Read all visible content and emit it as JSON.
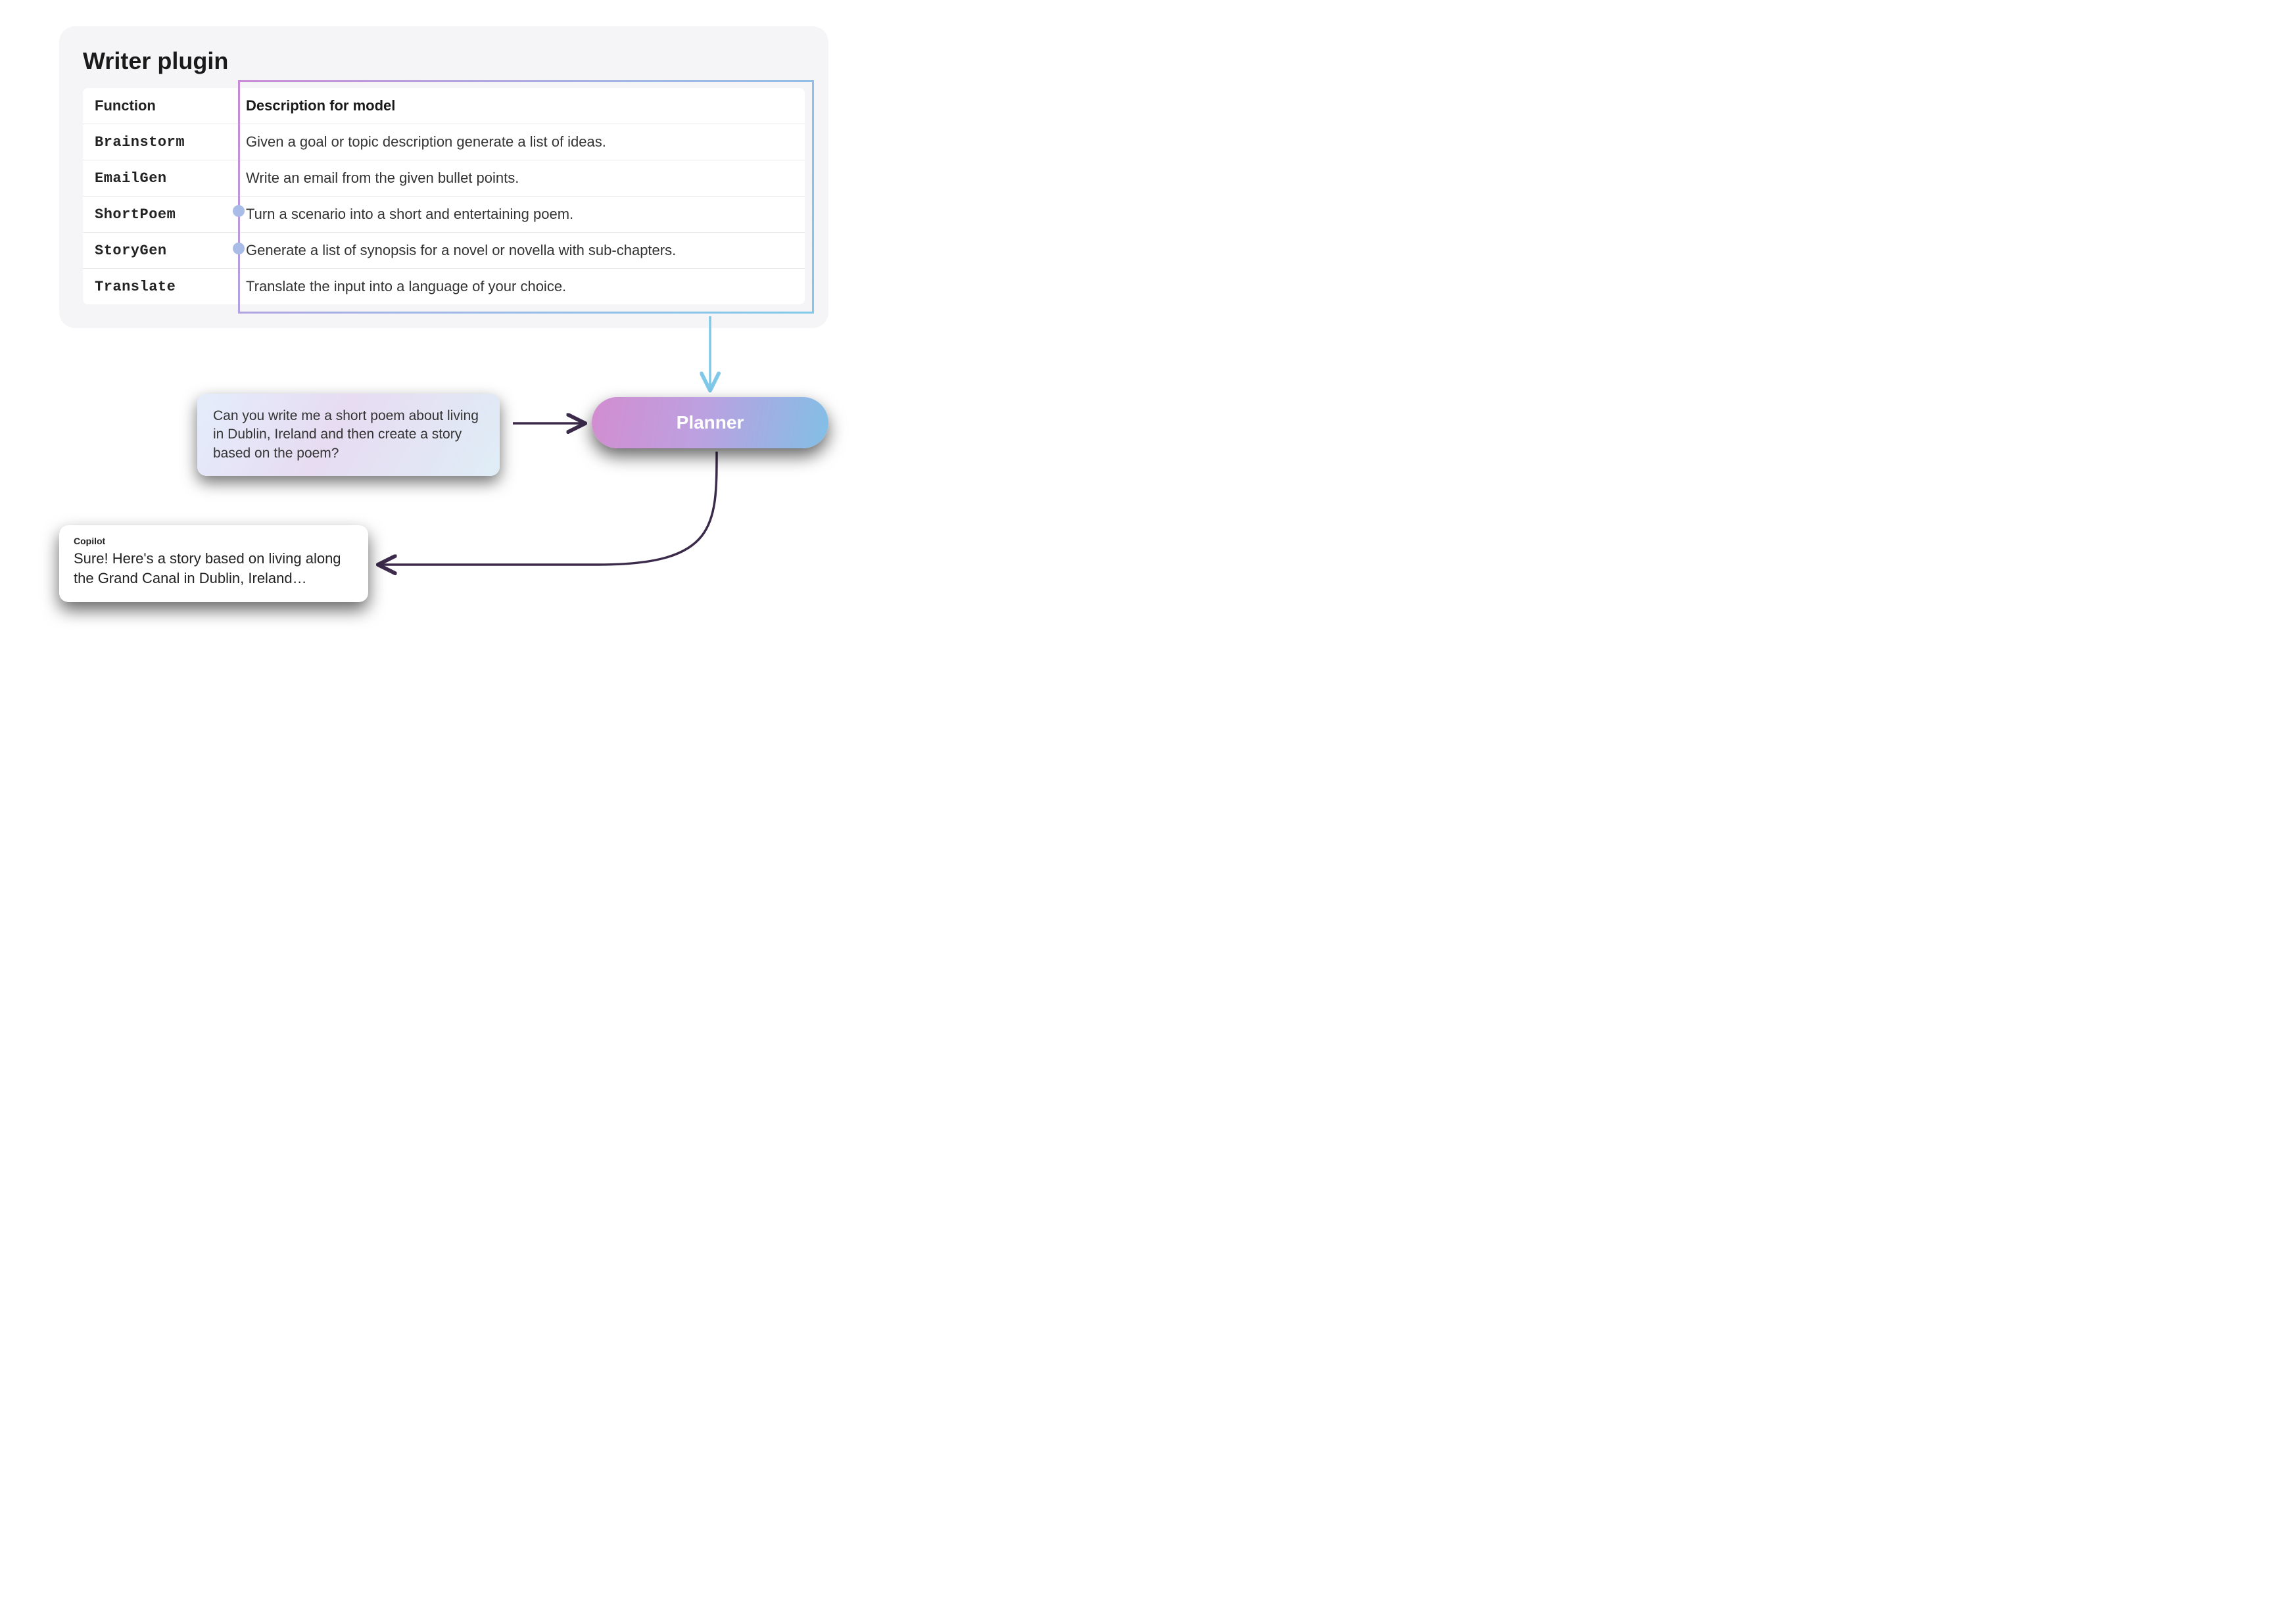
{
  "plugin": {
    "title": "Writer plugin",
    "header_fn": "Function",
    "header_desc": "Description for model",
    "rows": [
      {
        "fn": "Brainstorm",
        "desc": "Given a goal or topic description generate a list of ideas."
      },
      {
        "fn": "EmailGen",
        "desc": "Write an email from the given bullet points."
      },
      {
        "fn": "ShortPoem",
        "desc": "Turn a scenario into a short and entertaining poem."
      },
      {
        "fn": "StoryGen",
        "desc": "Generate a list of synopsis for a novel or novella with sub-chapters."
      },
      {
        "fn": "Translate",
        "desc": "Translate the input into a language of your choice."
      }
    ]
  },
  "user_prompt": "Can you write me a short poem about living in Dublin, Ireland and then create a story based on the poem?",
  "planner_label": "Planner",
  "copilot": {
    "label": "Copilot",
    "text": "Sure! Here's a story based on living along the Grand Canal in Dublin, Ireland…"
  }
}
